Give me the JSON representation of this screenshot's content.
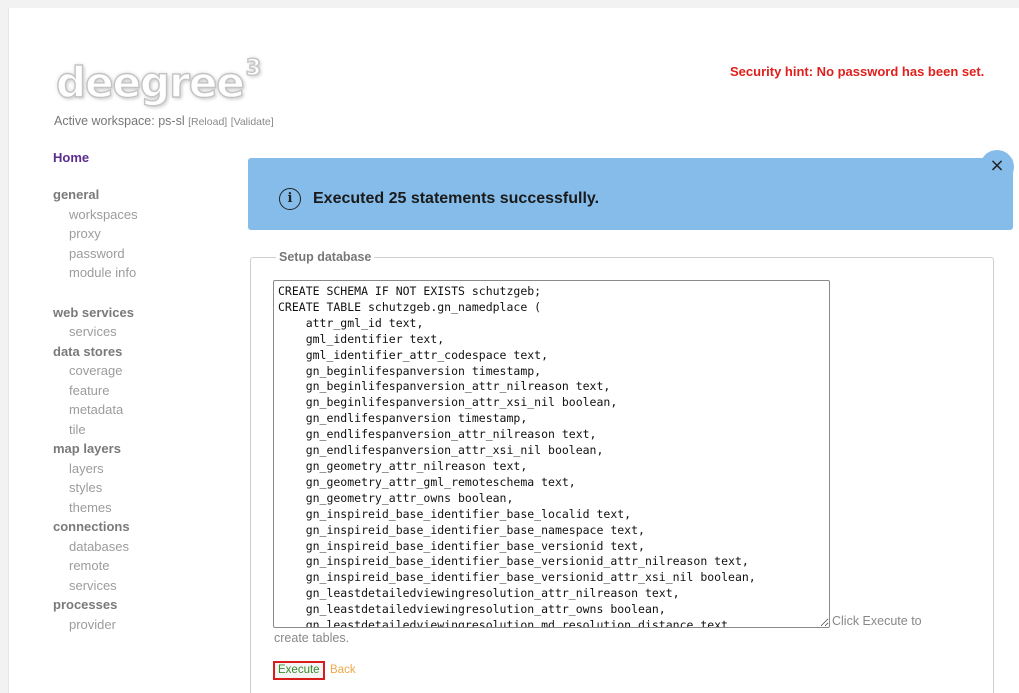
{
  "header": {
    "logo_text": "deegree",
    "logo_sup": "3",
    "security_hint": "Security hint: No password has been set.",
    "workspace_label": "Active workspace: ps-sl",
    "reload_label": "[Reload]",
    "validate_label": "[Validate]"
  },
  "nav": {
    "home": "Home",
    "general": {
      "title": "general",
      "items": [
        "workspaces",
        "proxy",
        "password",
        "module info"
      ]
    },
    "web_services": {
      "title": "web services",
      "items": [
        "services"
      ]
    },
    "data_stores": {
      "title": "data stores",
      "items": [
        "coverage",
        "feature",
        "metadata",
        "tile"
      ]
    },
    "map_layers": {
      "title": "map layers",
      "items": [
        "layers",
        "styles",
        "themes"
      ]
    },
    "connections": {
      "title": "connections",
      "items": [
        "databases",
        "remote",
        "services"
      ]
    },
    "processes": {
      "title": "processes",
      "items": [
        "provider"
      ]
    }
  },
  "alert": {
    "icon": "info-icon",
    "message": "Executed 25 statements successfully.",
    "close_glyph": "×"
  },
  "setup": {
    "legend": "Setup database",
    "sql": "CREATE SCHEMA IF NOT EXISTS schutzgeb;\nCREATE TABLE schutzgeb.gn_namedplace (\n    attr_gml_id text,\n    gml_identifier text,\n    gml_identifier_attr_codespace text,\n    gn_beginlifespanversion timestamp,\n    gn_beginlifespanversion_attr_nilreason text,\n    gn_beginlifespanversion_attr_xsi_nil boolean,\n    gn_endlifespanversion timestamp,\n    gn_endlifespanversion_attr_nilreason text,\n    gn_endlifespanversion_attr_xsi_nil boolean,\n    gn_geometry_attr_nilreason text,\n    gn_geometry_attr_gml_remoteschema text,\n    gn_geometry_attr_owns boolean,\n    gn_inspireid_base_identifier_base_localid text,\n    gn_inspireid_base_identifier_base_namespace text,\n    gn_inspireid_base_identifier_base_versionid text,\n    gn_inspireid_base_identifier_base_versionid_attr_nilreason text,\n    gn_inspireid_base_identifier_base_versionid_attr_xsi_nil boolean,\n    gn_leastdetailedviewingresolution_attr_nilreason text,\n    gn_leastdetailedviewingresolution_attr_owns boolean,\n    gn_leastdetailedviewingresolution_md_resolution_distance text,\n    gn_leastdetailedviewingresolution_md_resolution_distance_attr_uom text,\n    gn_leastdetailedviewingresolution_md_resolution_equivalentscale text",
    "hint_part1": "Click Execute to",
    "hint_part2": "create tables.",
    "execute_label": "Execute",
    "back_label": "Back"
  },
  "colors": {
    "alert_bg": "#85bce9",
    "security_red": "#e0201c",
    "home_purple": "#5b2d8e",
    "execute_green": "#3a8b2d",
    "back_orange": "#f0a74a"
  }
}
